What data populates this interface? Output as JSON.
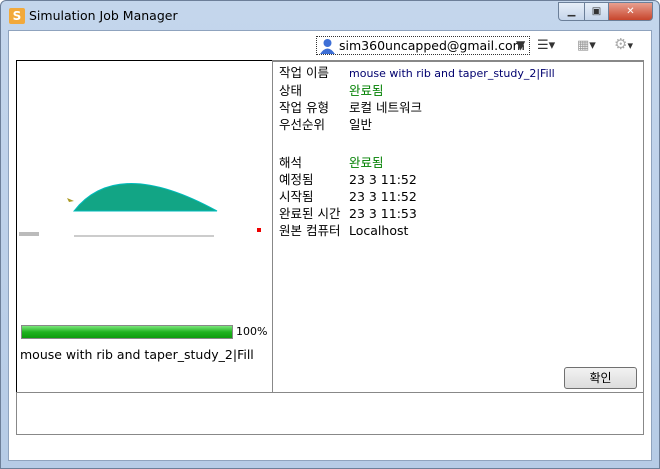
{
  "window": {
    "title": "Simulation Job Manager",
    "app_icon": "S"
  },
  "toolbar": {
    "user": "sim360uncapped@gmail.com"
  },
  "preview": {
    "progress_percent": 100,
    "progress_label": "100%",
    "job_caption": "mouse with rib and taper_study_2|Fill"
  },
  "details": [
    {
      "label": "작업 이름",
      "value": "mouse with rib and taper_study_2|Fill",
      "color": "#00006e"
    },
    {
      "label": "상태",
      "value": "완료됨",
      "color": "#008000"
    },
    {
      "label": "작업 유형",
      "value": "로컬 네트워크"
    },
    {
      "label": "우선순위",
      "value": "일반"
    },
    {
      "label": "해석",
      "value": "완료됨",
      "color": "#008000"
    },
    {
      "label": "예정됨",
      "value": "23 3 11:52"
    },
    {
      "label": "시작됨",
      "value": "23 3 11:52"
    },
    {
      "label": "완료된 시간",
      "value": "23 3 11:53"
    },
    {
      "label": "원본 컴퓨터",
      "value": "Localhost"
    }
  ],
  "ok_button": "확인"
}
